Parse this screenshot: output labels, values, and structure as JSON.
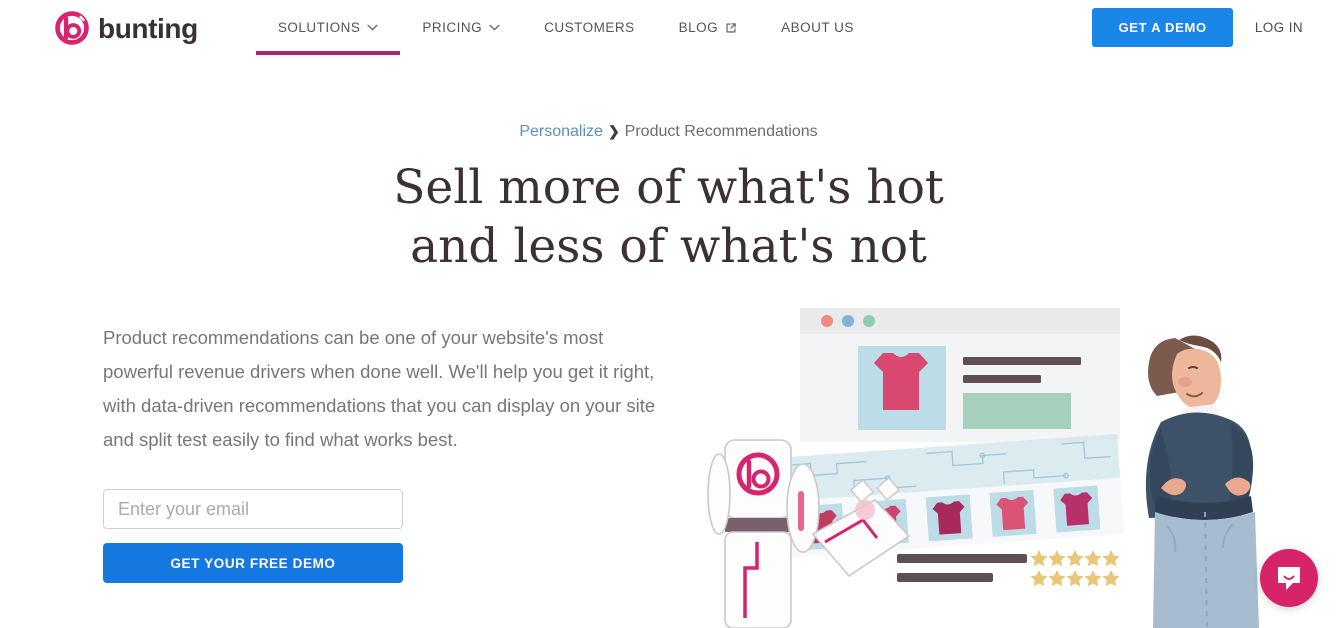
{
  "header": {
    "logo": {
      "mark_name": "bunting-b-mark",
      "wordmark": "bunting",
      "mark_color": "#d6246e",
      "word_color": "#3b2f36"
    },
    "nav": [
      {
        "label": "SOLUTIONS",
        "has_chevron": true,
        "has_external": false,
        "active": true
      },
      {
        "label": "PRICING",
        "has_chevron": true,
        "has_external": false,
        "active": false
      },
      {
        "label": "CUSTOMERS",
        "has_chevron": false,
        "has_external": false,
        "active": false
      },
      {
        "label": "BLOG",
        "has_chevron": false,
        "has_external": true,
        "active": false
      },
      {
        "label": "ABOUT US",
        "has_chevron": false,
        "has_external": false,
        "active": false
      }
    ],
    "cta_label": "GET A DEMO",
    "cta_color": "#1a86e8",
    "login_label": "LOG IN",
    "active_underline_color": "#b0266e"
  },
  "hero": {
    "breadcrumb": {
      "parent": "Personalize",
      "separator": "❯",
      "current": "Product Recommendations",
      "link_color": "#5a8fc2"
    },
    "headline_line1": "Sell more of what's hot",
    "headline_line2": "and less of what's not",
    "paragraph": "Product recommendations can be one of your website's most powerful revenue drivers when done well. We'll help you get it right, with data-driven recommendations that you can display on your site and split test easily to find what works best.",
    "form": {
      "email_placeholder": "Enter your email",
      "email_value": "",
      "submit_label": "GET YOUR FREE DEMO",
      "submit_color": "#1478e0"
    },
    "illustration": {
      "name": "product-recommendations-illustration",
      "browser_dots": [
        "#ef8a85",
        "#7fb2d4",
        "#92ccae"
      ],
      "featured_product_color": "#d94870",
      "thumbnail_tile_color": "#bcdce8",
      "robot_accent_color": "#d6246e",
      "star_color": "#e8c77a",
      "star_rows": 2,
      "stars_per_row": 5,
      "thumbnail_count": 5
    }
  },
  "widgets": {
    "intercom": {
      "label": "Open Intercom Messenger",
      "color": "#d6236a"
    }
  }
}
